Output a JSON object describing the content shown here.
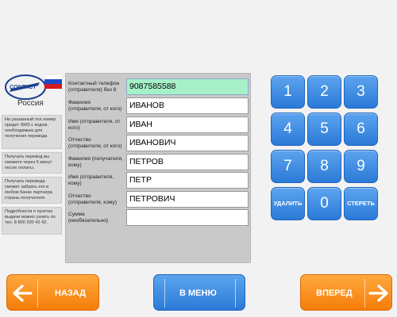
{
  "logo": {
    "brand": "CONTACT",
    "country": "Россия"
  },
  "notes": [
    "На указанный тел.номер придет SMS с кодом, необходимым для получения перевода",
    "Получать перевод вы сможете через 5 минут после оплаты.",
    "Получать перевода сможет забрать его в любом банке партнера страны получателя.",
    "Подробности о пунктах выдачи можно узнать по тел. 8 800 200 42 42."
  ],
  "form": {
    "fields": [
      {
        "label": "Контактный телефон (отправителя) без 8",
        "value": "9087585588"
      },
      {
        "label": "Фамилия (отправителя, от кого)",
        "value": "ИВАНОВ"
      },
      {
        "label": "Имя (отправителя, от кого)",
        "value": "ИВАН"
      },
      {
        "label": "Отчество (отправителя, от кого)",
        "value": "ИВАНОВИЧ"
      },
      {
        "label": "Фамилия (получателя, кому)",
        "value": "ПЕТРОВ"
      },
      {
        "label": "Имя (отправителя, кому)",
        "value": "ПЕТР"
      },
      {
        "label": "Отчество (отправителя, кому)",
        "value": "ПЕТРОВИЧ"
      },
      {
        "label": "Сумма (необязательно)",
        "value": ""
      }
    ]
  },
  "keypad": {
    "keys": [
      "1",
      "2",
      "3",
      "4",
      "5",
      "6",
      "7",
      "8",
      "9",
      "УДАЛИТЬ",
      "0",
      "СТЕРЕТЬ"
    ]
  },
  "nav": {
    "back_label": "НАЗАД",
    "menu_label": "В МЕНЮ",
    "next_label": "ВПЕРЕД"
  },
  "colors": {
    "accent_blue": "#2b7ad8",
    "accent_orange": "#f57d0a",
    "active_field": "#a7f1c8"
  }
}
